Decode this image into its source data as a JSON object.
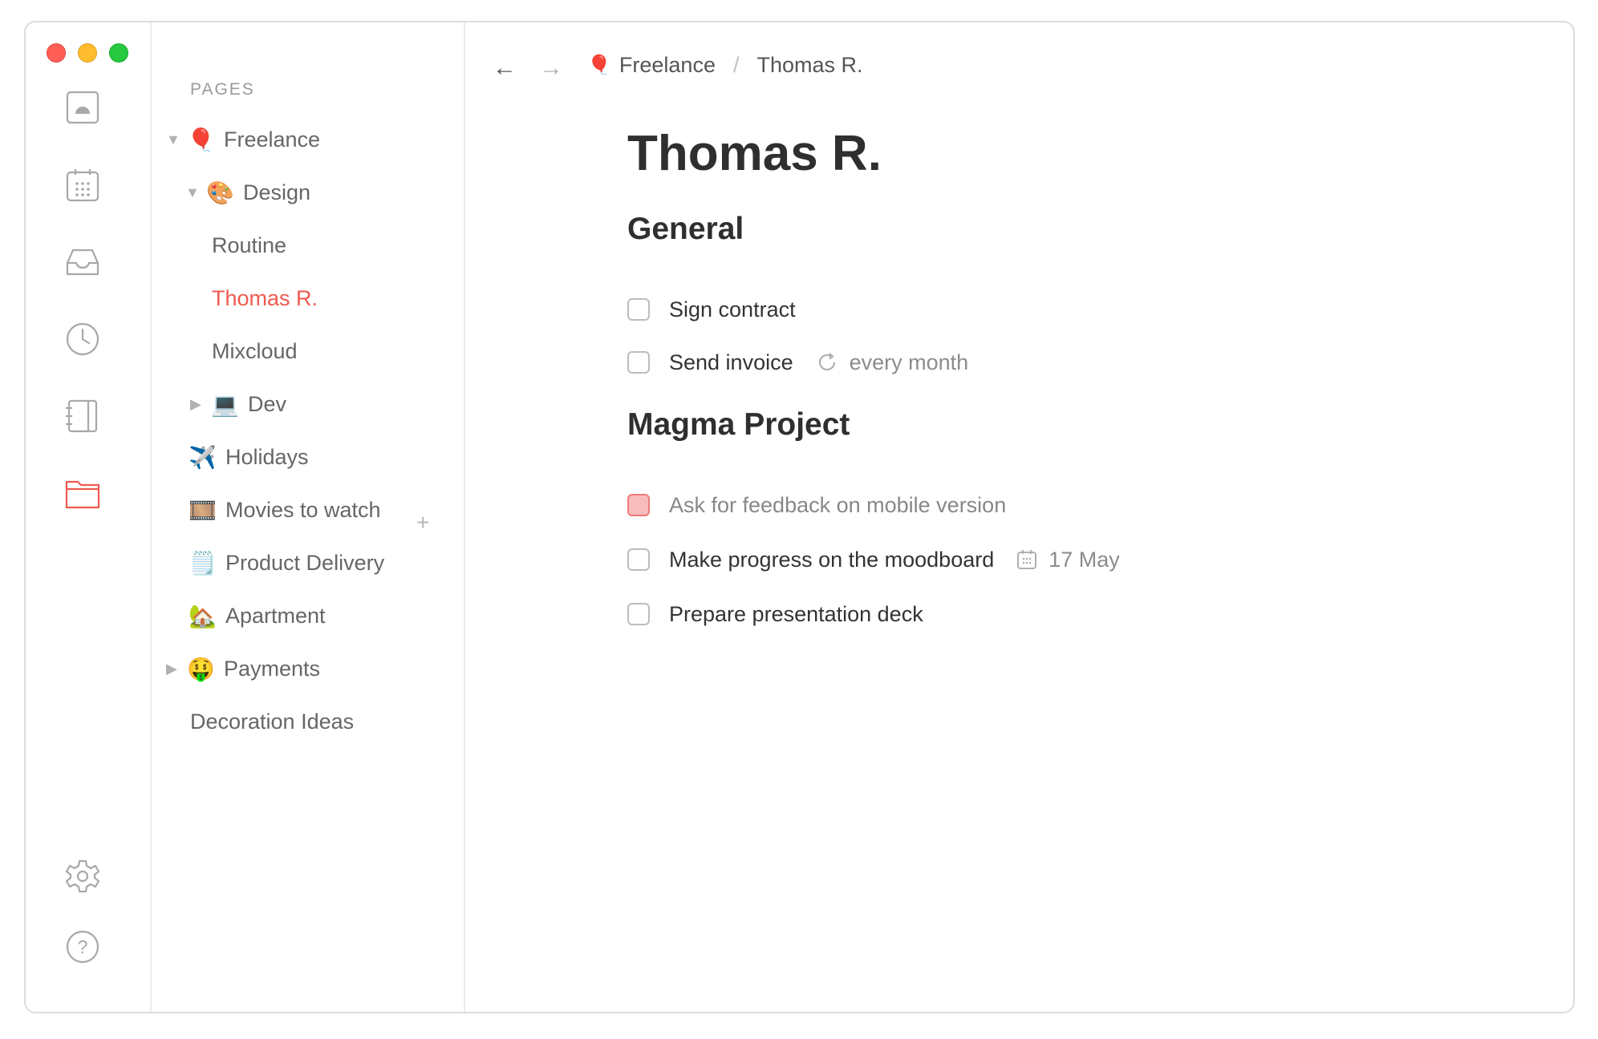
{
  "sidebar": {
    "section_label": "PAGES",
    "items": [
      {
        "label": "Freelance",
        "emoji": "🎈",
        "caret": "▼"
      },
      {
        "label": "Design",
        "emoji": "🎨",
        "caret": "▼"
      },
      {
        "label": "Routine"
      },
      {
        "label": "Thomas R.",
        "active": true
      },
      {
        "label": "Mixcloud"
      },
      {
        "label": "Dev",
        "emoji": "💻",
        "caret": "▶"
      },
      {
        "label": "Holidays",
        "emoji": "✈️"
      },
      {
        "label": "Movies to watch",
        "emoji": "🎞️"
      },
      {
        "label": "Product Delivery",
        "emoji": "🗒️"
      },
      {
        "label": "Apartment",
        "emoji": "🏡"
      },
      {
        "label": "Payments",
        "emoji": "🤑",
        "caret": "▶"
      },
      {
        "label": "Decoration Ideas"
      }
    ],
    "add_glyph": "+"
  },
  "rail": {
    "icons": [
      "home-icon",
      "calendar-icon",
      "inbox-icon",
      "clock-icon",
      "notebook-icon",
      "folder-icon",
      "gear-icon",
      "help-icon"
    ],
    "active_color": "#ef5a4f"
  },
  "nav": {
    "back": "←",
    "forward": "→"
  },
  "breadcrumb": {
    "emoji": "🎈",
    "parent": "Freelance",
    "separator": "/",
    "current": "Thomas R."
  },
  "page": {
    "title": "Thomas R.",
    "sections": [
      {
        "heading": "General",
        "tasks": [
          {
            "label": "Sign contract"
          },
          {
            "label": "Send invoice",
            "meta": "every month"
          }
        ]
      },
      {
        "heading": "Magma Project",
        "tasks": [
          {
            "label": "Ask for feedback on mobile version",
            "highlight": true
          },
          {
            "label": "Make progress on the moodboard",
            "meta": "17 May"
          },
          {
            "label": "Prepare presentation deck"
          }
        ]
      }
    ]
  }
}
